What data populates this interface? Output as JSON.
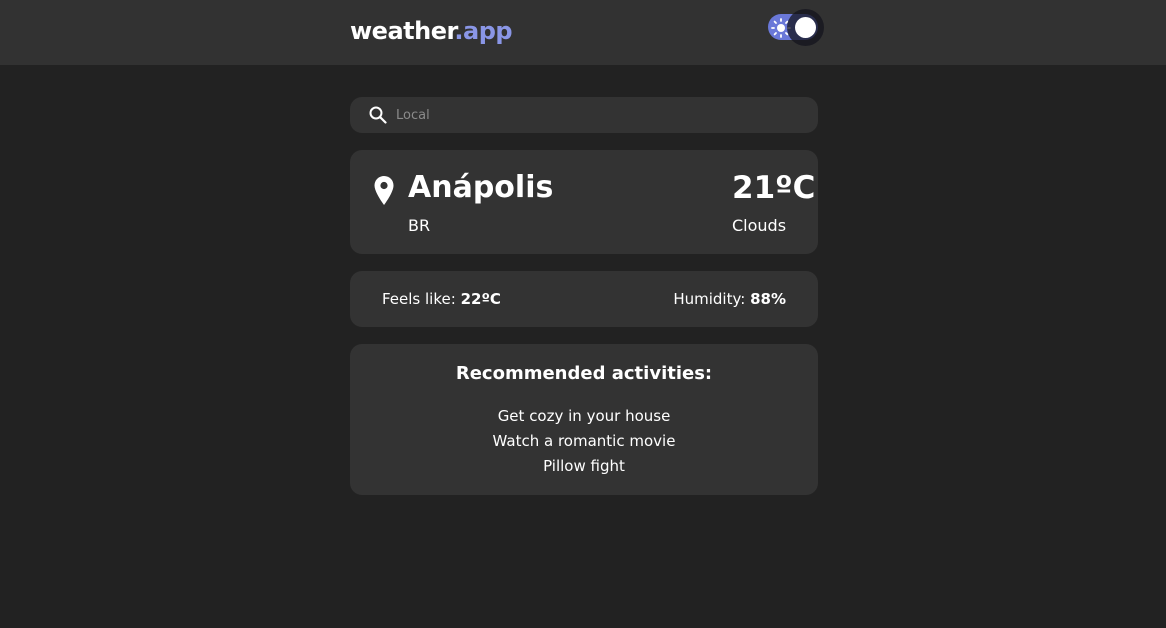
{
  "header": {
    "logo_main": "weather",
    "logo_accent": ".app",
    "theme_toggle": {
      "mode": "dark",
      "icon": "sun-icon"
    }
  },
  "search": {
    "placeholder": "Local",
    "value": "",
    "icon": "search-icon"
  },
  "location": {
    "icon": "map-pin-icon",
    "city": "Anápolis",
    "country": "BR",
    "temperature": "21ºC",
    "condition": "Clouds"
  },
  "details": {
    "feels_like_label": "Feels like:",
    "feels_like_value": "22ºC",
    "humidity_label": "Humidity:",
    "humidity_value": "88%"
  },
  "activities": {
    "title": "Recommended activities:",
    "items": [
      "Get cozy in your house",
      "Watch a romantic movie",
      "Pillow fight"
    ]
  },
  "colors": {
    "background": "#222222",
    "header": "#323232",
    "card": "#333333",
    "accent": "#8a96e6"
  }
}
